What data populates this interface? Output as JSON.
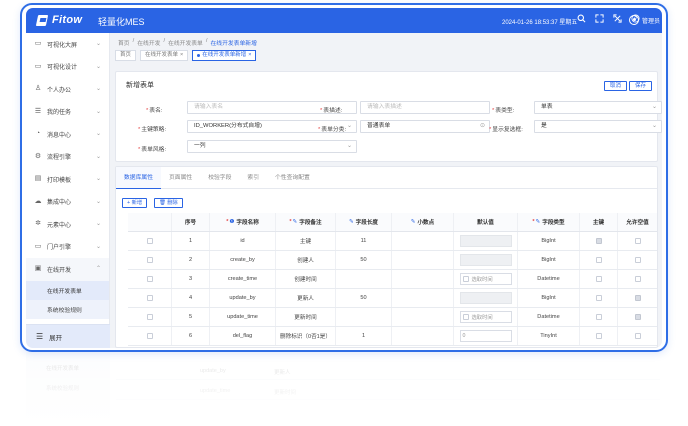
{
  "app": {
    "logo_text": "Fitow",
    "product_name": "轻量化MES",
    "datetime": "2024-01-26 18:53:37 星期五",
    "user_name": "管理员",
    "header_icons": [
      "search-icon",
      "fullscreen-icon",
      "sync-icon",
      "question-icon"
    ]
  },
  "sidebar": {
    "items": [
      {
        "label": "可视化大屏",
        "icon": "screen-icon"
      },
      {
        "label": "可视化设计",
        "icon": "design-icon"
      },
      {
        "label": "个人办公",
        "icon": "person-icon"
      },
      {
        "label": "我的任务",
        "icon": "task-icon"
      },
      {
        "label": "消息中心",
        "icon": "bell-icon"
      },
      {
        "label": "流程引擎",
        "icon": "flow-icon"
      },
      {
        "label": "打印模板",
        "icon": "print-icon"
      },
      {
        "label": "集成中心",
        "icon": "cloud-icon"
      },
      {
        "label": "元素中心",
        "icon": "element-icon"
      },
      {
        "label": "门户引擎",
        "icon": "portal-icon"
      },
      {
        "label": "在线开发",
        "icon": "code-icon"
      }
    ],
    "submenu": [
      {
        "label": "在线开发表单"
      },
      {
        "label": "系统校验规则"
      }
    ],
    "collapse_label": "展开"
  },
  "breadcrumb": {
    "items": [
      "首页",
      "在线开发",
      "在线开发表单",
      "在线开发表单新增"
    ],
    "separator": "/"
  },
  "page_tabs": [
    {
      "label": "首页"
    },
    {
      "label": "在线开发表单"
    },
    {
      "label": "在线开发表单新增"
    }
  ],
  "form": {
    "title": "新增表单",
    "cancel_label": "取消",
    "save_label": "保存",
    "fields": {
      "table_name": {
        "label": "表名:",
        "placeholder": "请输入表名"
      },
      "table_desc": {
        "label": "表描述:",
        "placeholder": "请输入表描述"
      },
      "table_type": {
        "label": "表类型:",
        "value": "单表"
      },
      "pk_strategy": {
        "label": "主键策略:",
        "value": "ID_WORKER(分布式自增)"
      },
      "table_category": {
        "label": "表单分类:",
        "value": "普通表单"
      },
      "show_checkbox": {
        "label": "显示复选框:",
        "value": "是"
      },
      "form_style": {
        "label": "表单风格:",
        "value": "一列"
      }
    }
  },
  "table_tabs": [
    "数据库属性",
    "页面属性",
    "校验字段",
    "索引",
    "个性查询配置"
  ],
  "table_buttons": {
    "add": "+ 新增",
    "delete": "删除"
  },
  "columns": [
    "序号",
    "字段名称",
    "字段备注",
    "字段长度",
    "小数点",
    "默认值",
    "字段类型",
    "主键",
    "允许空值"
  ],
  "rows": [
    {
      "no": "1",
      "name": "id",
      "remark": "主键",
      "length": "11",
      "default": "",
      "type": "BigInt",
      "pk": true,
      "nullable": false
    },
    {
      "no": "2",
      "name": "create_by",
      "remark": "创建人",
      "length": "50",
      "default": "",
      "type": "BigInt",
      "pk": false,
      "nullable": false
    },
    {
      "no": "3",
      "name": "create_time",
      "remark": "创建时间",
      "length": "",
      "default": "选取时间",
      "type": "Datetime",
      "pk": false,
      "nullable": false
    },
    {
      "no": "4",
      "name": "update_by",
      "remark": "更新人",
      "length": "50",
      "default": "",
      "type": "BigInt",
      "pk": false,
      "nullable": true
    },
    {
      "no": "5",
      "name": "update_time",
      "remark": "更新时间",
      "length": "",
      "default": "选取时间",
      "type": "Datetime",
      "pk": false,
      "nullable": true
    },
    {
      "no": "6",
      "name": "del_flag",
      "remark": "删除标识（0否1是）",
      "length": "1",
      "default": "0",
      "type": "TinyInt",
      "pk": false,
      "nullable": false
    }
  ],
  "colors": {
    "accent": "#2a64e4",
    "frame": "#2f6ee6",
    "required": "#e54848"
  }
}
